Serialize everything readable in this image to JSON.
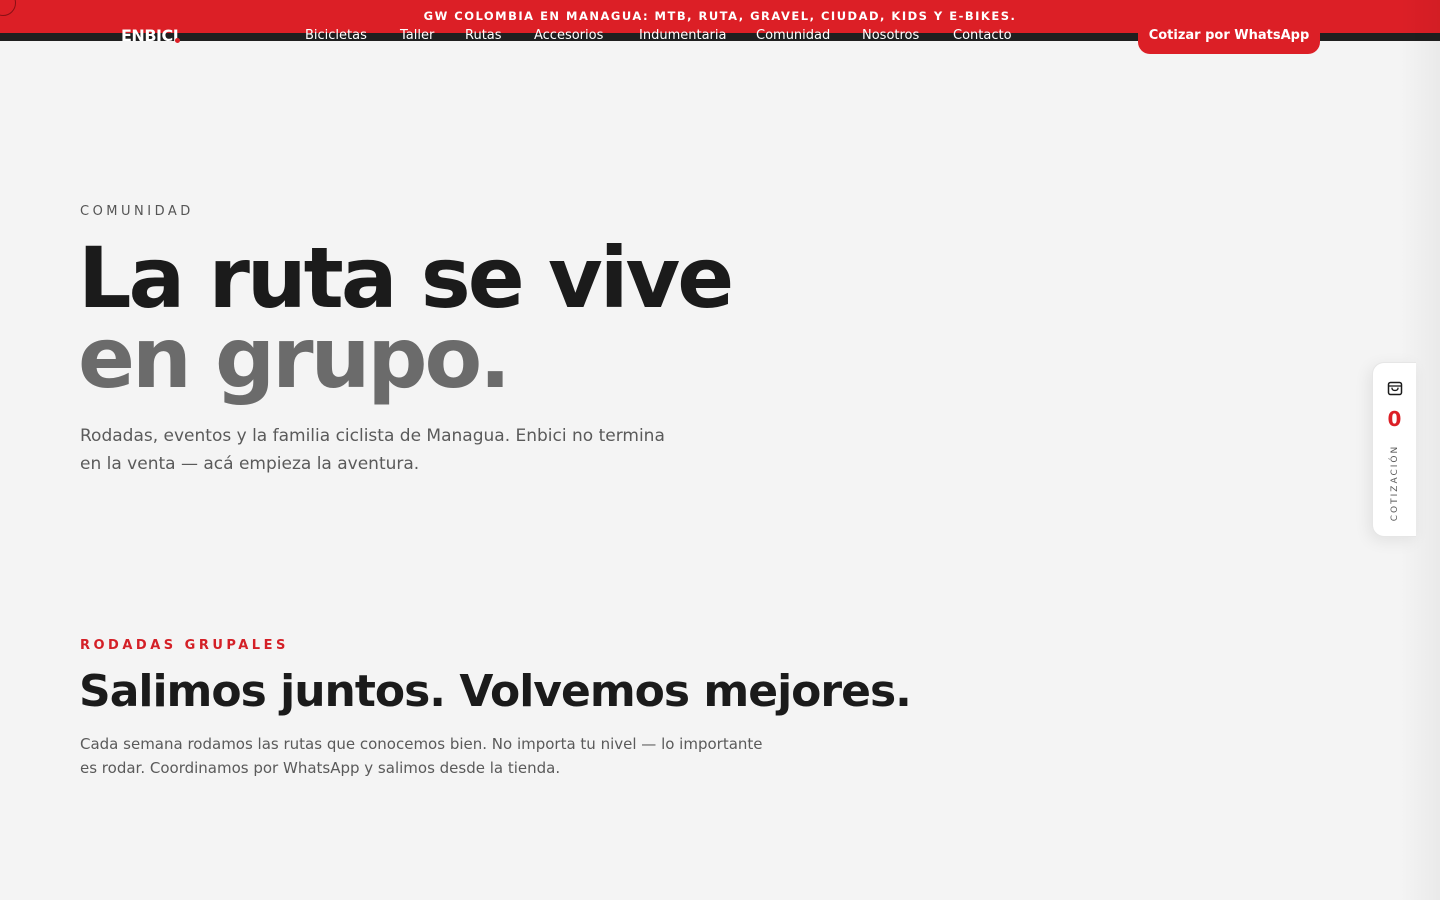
{
  "announcement": {
    "text": "GW COLOMBIA EN MANAGUA: MTB, RUTA, GRAVEL, CIUDAD, KIDS Y E-BIKES."
  },
  "brand": {
    "logo": "ENBICI",
    "accent_color": "#dc1f26",
    "dark_color": "#1b1b1b"
  },
  "nav": {
    "items": [
      {
        "label": "Bicicletas"
      },
      {
        "label": "Taller"
      },
      {
        "label": "Rutas"
      },
      {
        "label": "Accesorios"
      },
      {
        "label": "Indumentaria"
      },
      {
        "label": "Comunidad"
      },
      {
        "label": "Nosotros"
      },
      {
        "label": "Contacto"
      }
    ],
    "cta_label": "Cotizar por WhatsApp"
  },
  "hero": {
    "eyebrow": "COMUNIDAD",
    "title_line1": "La ruta se vive",
    "title_line2": "en grupo.",
    "para_line1": "Rodadas, eventos y la familia ciclista de Managua. Enbici no termina",
    "para_line2": "en la venta — acá empieza la aventura."
  },
  "section": {
    "eyebrow": "RODADAS GRUPALES",
    "title": "Salimos juntos. Volvemos mejores.",
    "para_line1": "Cada semana rodamos las rutas que conocemos bien. No importa tu nivel — lo importante",
    "para_line2": "es rodar. Coordinamos por WhatsApp y salimos desde la tienda."
  },
  "quote_widget": {
    "icon": "shopping-bag-icon",
    "count": "0",
    "label": "COTIZACIÓN"
  }
}
